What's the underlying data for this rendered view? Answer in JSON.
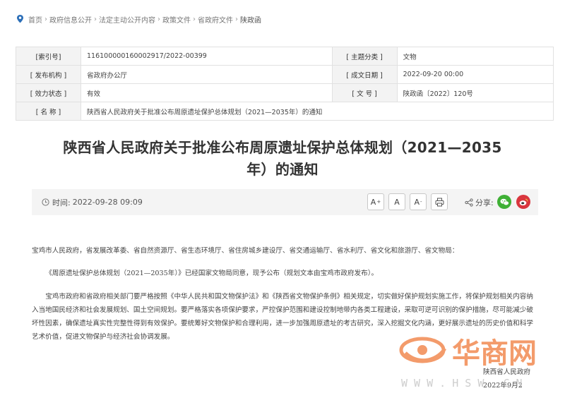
{
  "breadcrumb": {
    "items": [
      "首页",
      "政府信息公开",
      "法定主动公开内容",
      "政策文件",
      "省政府文件",
      "陕政函"
    ],
    "separator": "›"
  },
  "meta": {
    "index_no_label": "[索引号]",
    "index_no": "11610000016000291​7/2022-00399",
    "topic_label": "[ 主题分类 ]",
    "topic": "文物",
    "publisher_label": "[ 发布机构 ]",
    "publisher": "省政府办公厅",
    "date_label": "[ 成文日期 ]",
    "date": "2022-09-20 00:00",
    "validity_label": "[ 效力状态 ]",
    "validity": "有效",
    "docno_label": "[ 文    号 ]",
    "docno": "陕政函〔2022〕120号",
    "name_label": "[ 名    称 ]",
    "name": "陕西省人民政府关于批准公布周原遗址保护总体规划（2021—2035年）的通知"
  },
  "title": {
    "line1": "陕西省人民政府关于批准公布周原遗址保护总体规划（2021—2035",
    "line2": "年）的通知"
  },
  "toolbar": {
    "time_label": "时间:",
    "time": "2022-09-28 09:09",
    "font_large": "A",
    "font_normal": "A",
    "font_small": "A",
    "share_label": "分享:"
  },
  "body": {
    "addressee": "宝鸡市人民政府，省发展改革委、省自然资源厅、省生态环境厅、省住房城乡建设厅、省交通运输厅、省水利厅、省文化和旅游厅、省文物局：",
    "para1": "《周原遗址保护总体规划（2021—2035年）》已经国家文物局同意，现予公布（规划文本由宝鸡市政府发布）。",
    "para2": "宝鸡市政府和省政府相关部门要严格按照《中华人民共和国文物保护法》和《陕西省文物保护条例》相关规定，切实做好保护规划实施工作，将保护规划相关内容纳入当地国民经济和社会发展规划、国土空间规划。要严格落实各项保护要求，严控保护范围和建设控制地带内各类工程建设，采取可逆可识别的保护措施，尽可能减少破坏性因素，确保遗址真实性完整性得到有效保护。要统筹好文物保护和合理利用，进一步加强周原遗址的考古研究，深入挖掘文化内涵，更好展示遗址的历史价值和科学艺术价值，促进文物保护与经济社会协调发展。",
    "signature": "陕西省人民政府",
    "sign_date": "2022年9月2"
  },
  "watermark": {
    "brand": "华商网",
    "domain": "W W W . H S W . C N"
  },
  "colors": {
    "wechat": "#3fb035",
    "weibo": "#d9363e",
    "watermark": "#f07a3a",
    "toolbar_bg": "#f4f4f4"
  },
  "icons": [
    "location-icon",
    "clock-icon",
    "print-icon",
    "share-icon",
    "wechat-icon",
    "weibo-icon"
  ]
}
